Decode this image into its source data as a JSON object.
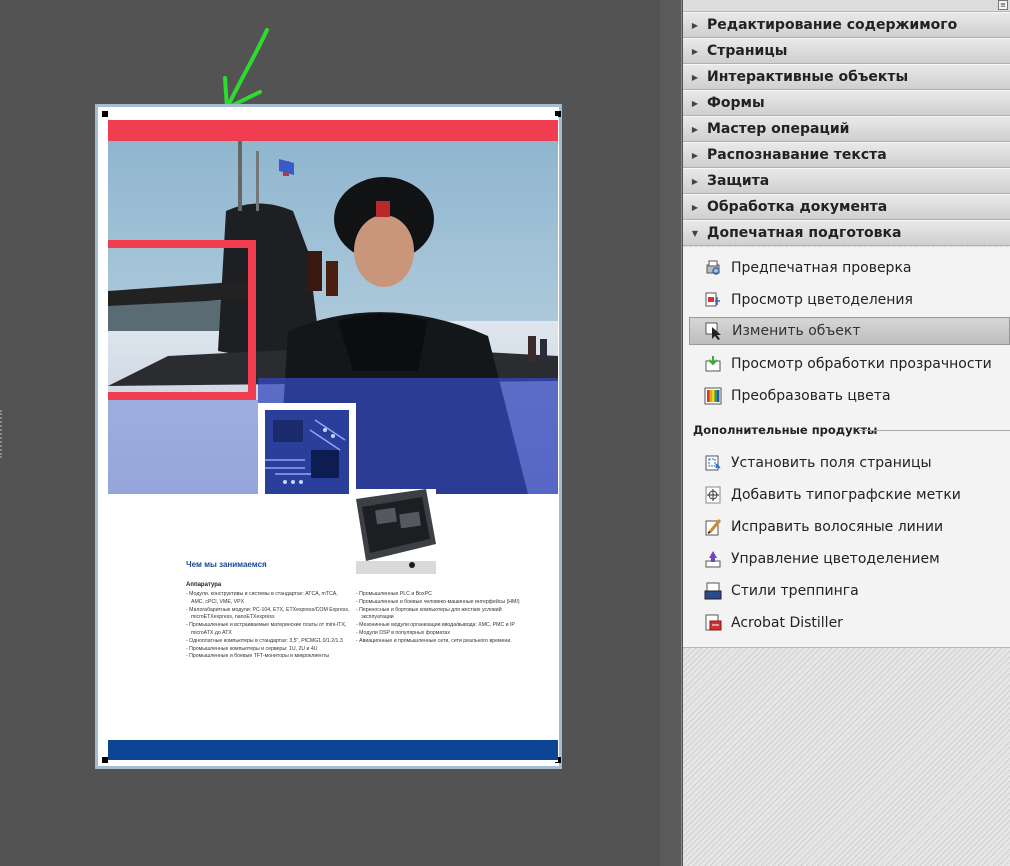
{
  "panel": {
    "sections": [
      {
        "label": "Редактирование содержимого"
      },
      {
        "label": "Страницы"
      },
      {
        "label": "Интерактивные объекты"
      },
      {
        "label": "Формы"
      },
      {
        "label": "Мастер операций"
      },
      {
        "label": "Распознавание текста"
      },
      {
        "label": "Защита"
      },
      {
        "label": "Обработка документа"
      },
      {
        "label": "Допечатная подготовка"
      }
    ],
    "prepress_tools": [
      {
        "label": "Предпечатная проверка",
        "icon": "preflight-icon"
      },
      {
        "label": "Просмотр цветоделения",
        "icon": "output-preview-icon"
      },
      {
        "label": "Изменить объект",
        "icon": "edit-object-icon",
        "selected": true
      },
      {
        "label": "Просмотр обработки прозрачности",
        "icon": "flattener-preview-icon"
      },
      {
        "label": "Преобразовать цвета",
        "icon": "convert-colors-icon"
      }
    ],
    "extra_label": "Дополнительные продукты",
    "extra_tools": [
      {
        "label": "Установить поля страницы",
        "icon": "set-page-boxes-icon"
      },
      {
        "label": "Добавить типографские метки",
        "icon": "printer-marks-icon"
      },
      {
        "label": "Исправить волосяные линии",
        "icon": "fix-hairlines-icon"
      },
      {
        "label": "Управление цветоделением",
        "icon": "ink-manager-icon"
      },
      {
        "label": "Стили треппинга",
        "icon": "trap-presets-icon"
      },
      {
        "label": "Acrobat Distiller",
        "icon": "acrobat-distiller-icon"
      }
    ]
  },
  "document": {
    "heading": "Чем мы занимаемся",
    "subheading": "Аппаратура",
    "col_left": [
      "Модули, конструктивы и системы в стандартах: ATCA, mTCA, AMC, cPCI, VME, VPX",
      "Малогабаритные модули: PC-104, ETX, ETXexpress/COM Express, microETXexpress, nanoETXexpress",
      "Промышленные и встраиваемые материнские платы от mini-ITX, microATX до ATX",
      "Одноплатные компьютеры в стандартах: 3,5\", PICMG1.0/1.2/1.3",
      "Промышленные компьютеры и серверы: 1U, 2U и 4U",
      "Промышленные и боевые TFT-мониторы и микроклиенты"
    ],
    "col_right": [
      "Промышленные PLC и BoxPC",
      "Промышленные и боевые человеко-машинные интерфейсы (HMI)",
      "Переносные и бортовые компьютеры для жестких условий эксплуатации",
      "Мезонинные модули организации ввода/вывода: XMC, PMC и IP",
      "Модули DSP в популярных форматах",
      "Авиационные и промышленные сети, сети реального времени."
    ]
  },
  "colors": {
    "red_bar": "#f03d50",
    "blue_bar": "#0d4596",
    "annotation_arrow": "#2edc2e"
  }
}
